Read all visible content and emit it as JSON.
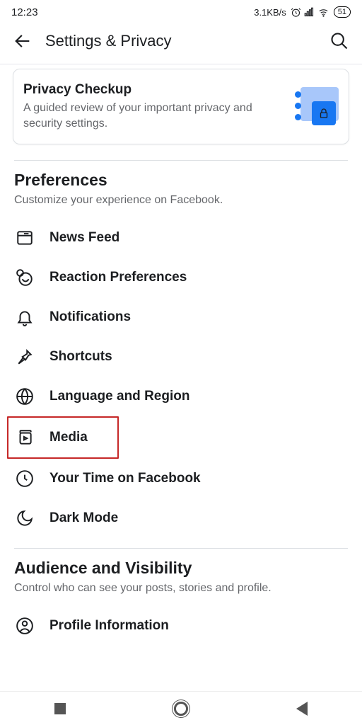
{
  "status": {
    "time": "12:23",
    "net": "3.1KB/s",
    "battery": "51"
  },
  "header": {
    "title": "Settings & Privacy"
  },
  "card": {
    "title": "Privacy Checkup",
    "sub": "A guided review of your important privacy and security settings."
  },
  "preferences": {
    "title": "Preferences",
    "sub": "Customize your experience on Facebook.",
    "items": [
      {
        "label": "News Feed"
      },
      {
        "label": "Reaction Preferences"
      },
      {
        "label": "Notifications"
      },
      {
        "label": "Shortcuts"
      },
      {
        "label": "Language and Region"
      },
      {
        "label": "Media"
      },
      {
        "label": "Your Time on Facebook"
      },
      {
        "label": "Dark Mode"
      }
    ]
  },
  "audience": {
    "title": "Audience and Visibility",
    "sub": "Control who can see your posts, stories and profile.",
    "items": [
      {
        "label": "Profile Information"
      }
    ]
  }
}
